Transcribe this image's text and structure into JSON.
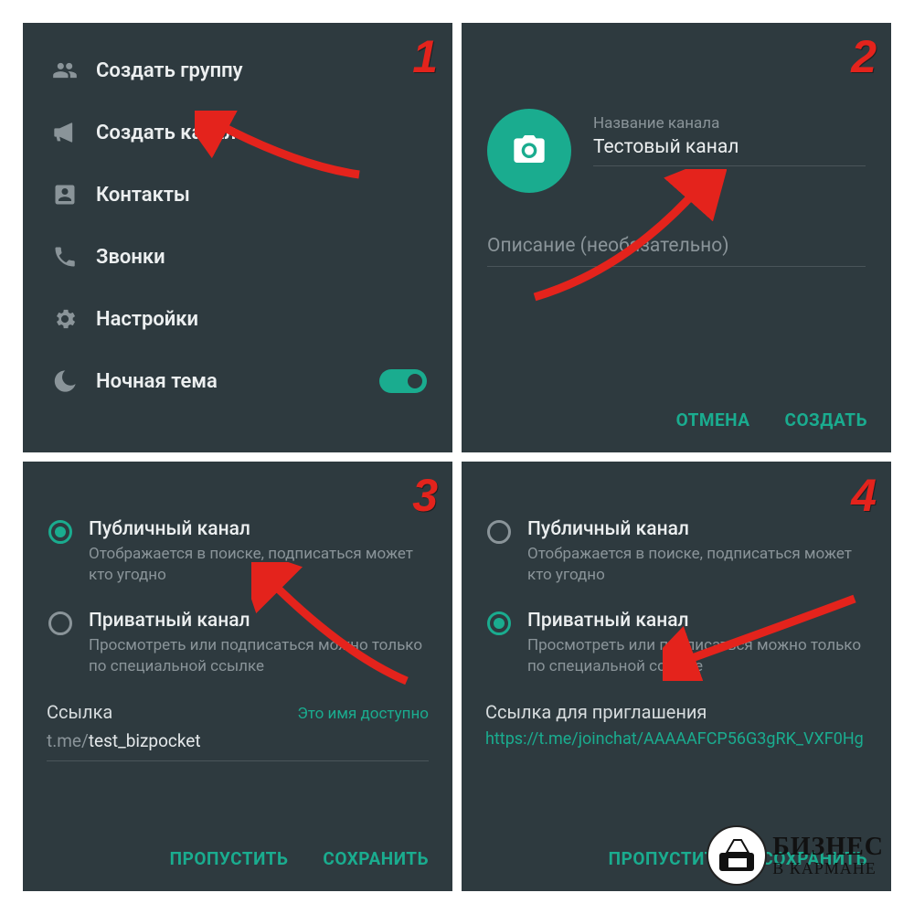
{
  "accent": "#1aac8f",
  "step_labels": {
    "s1": "1",
    "s2": "2",
    "s3": "3",
    "s4": "4"
  },
  "panel1": {
    "menu": [
      {
        "icon": "group-icon",
        "label": "Создать группу"
      },
      {
        "icon": "megaphone-icon",
        "label": "Создать канал"
      },
      {
        "icon": "contact-icon",
        "label": "Контакты"
      },
      {
        "icon": "phone-icon",
        "label": "Звонки"
      },
      {
        "icon": "gear-icon",
        "label": "Настройки"
      },
      {
        "icon": "moon-icon",
        "label": "Ночная тема"
      }
    ],
    "night_mode_on": true
  },
  "panel2": {
    "name_label": "Название канала",
    "name_value": "Тестовый канал",
    "desc_placeholder": "Описание (необязательно)",
    "cancel": "ОТМЕНА",
    "create": "СОЗДАТЬ"
  },
  "panel3": {
    "options": [
      {
        "title": "Публичный канал",
        "desc": "Отображается в поиске, подписаться может кто угодно",
        "checked": true
      },
      {
        "title": "Приватный канал",
        "desc": "Просмотреть или подписаться можно только по специальной ссылке",
        "checked": false
      }
    ],
    "link_label": "Ссылка",
    "link_available": "Это имя доступно",
    "link_prefix": "t.me/",
    "link_slug": "test_bizpocket",
    "skip": "ПРОПУСТИТЬ",
    "save": "СОХРАНИТЬ"
  },
  "panel4": {
    "options": [
      {
        "title": "Публичный канал",
        "desc": "Отображается в поиске, подписаться может кто угодно",
        "checked": false
      },
      {
        "title": "Приватный канал",
        "desc": "Просмотреть или подписаться можно только по специальной ссылке",
        "checked": true
      }
    ],
    "invite_label": "Ссылка для приглашения",
    "invite_link": "https://t.me/joinchat/AAAAAFCP56G3gRK_VXF0Hg",
    "skip": "ПРОПУСТИТЬ",
    "save": "СОХРАНИТЬ"
  },
  "watermark": {
    "line1": "БИЗНЕС",
    "line2": "В КАРМАНЕ"
  }
}
